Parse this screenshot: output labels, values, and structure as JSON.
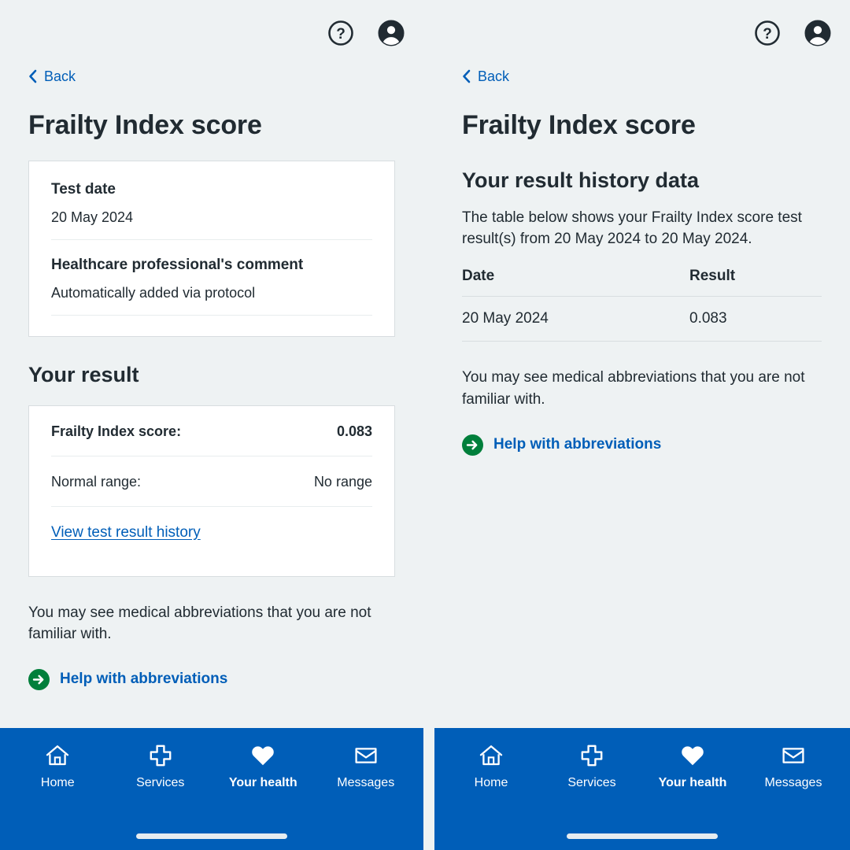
{
  "theme": {
    "page_bg": "#eef2f3",
    "brand_blue": "#005eb8",
    "link_blue": "#005eb8",
    "text_dark": "#212b32",
    "green": "#007f3b",
    "card_bg": "#ffffff",
    "card_border": "#d8dde0"
  },
  "header": {
    "help_icon": "help-circle-icon",
    "account_icon": "account-circle-icon"
  },
  "left_screen": {
    "back_label": "Back",
    "back_icon": "chevron-left-icon",
    "title": "Frailty Index score",
    "detail_card": {
      "test_date_label": "Test date",
      "test_date_value": "20 May 2024",
      "comment_label": "Healthcare professional's comment",
      "comment_value": "Automatically added via protocol"
    },
    "result_section_title": "Your result",
    "result_card": {
      "rows": [
        {
          "label": "Frailty Index score:",
          "value": "0.083"
        },
        {
          "label": "Normal range:",
          "value": "No range"
        }
      ],
      "history_link": "View test result history"
    },
    "abbrev_text": "You may see medical abbreviations that you are not familiar with.",
    "help_link_label": "Help with abbreviations",
    "help_link_icon": "arrow-right-circle-icon"
  },
  "right_screen": {
    "back_label": "Back",
    "back_icon": "chevron-left-icon",
    "title": "Frailty Index score",
    "history_title": "Your result history data",
    "history_desc": "The table below shows your Frailty Index score test result(s) from 20 May 2024 to 20 May 2024.",
    "table": {
      "columns": [
        "Date",
        "Result"
      ],
      "rows": [
        {
          "date": "20 May 2024",
          "result": "0.083"
        }
      ]
    },
    "abbrev_text": "You may see medical abbreviations that you are not familiar with.",
    "help_link_label": "Help with abbreviations",
    "help_link_icon": "arrow-right-circle-icon"
  },
  "bottom_nav": {
    "items": [
      {
        "label": "Home",
        "icon": "home-icon",
        "active": false
      },
      {
        "label": "Services",
        "icon": "plus-cross-icon",
        "active": false
      },
      {
        "label": "Your health",
        "icon": "heart-icon",
        "active": true
      },
      {
        "label": "Messages",
        "icon": "envelope-icon",
        "active": false
      }
    ]
  }
}
